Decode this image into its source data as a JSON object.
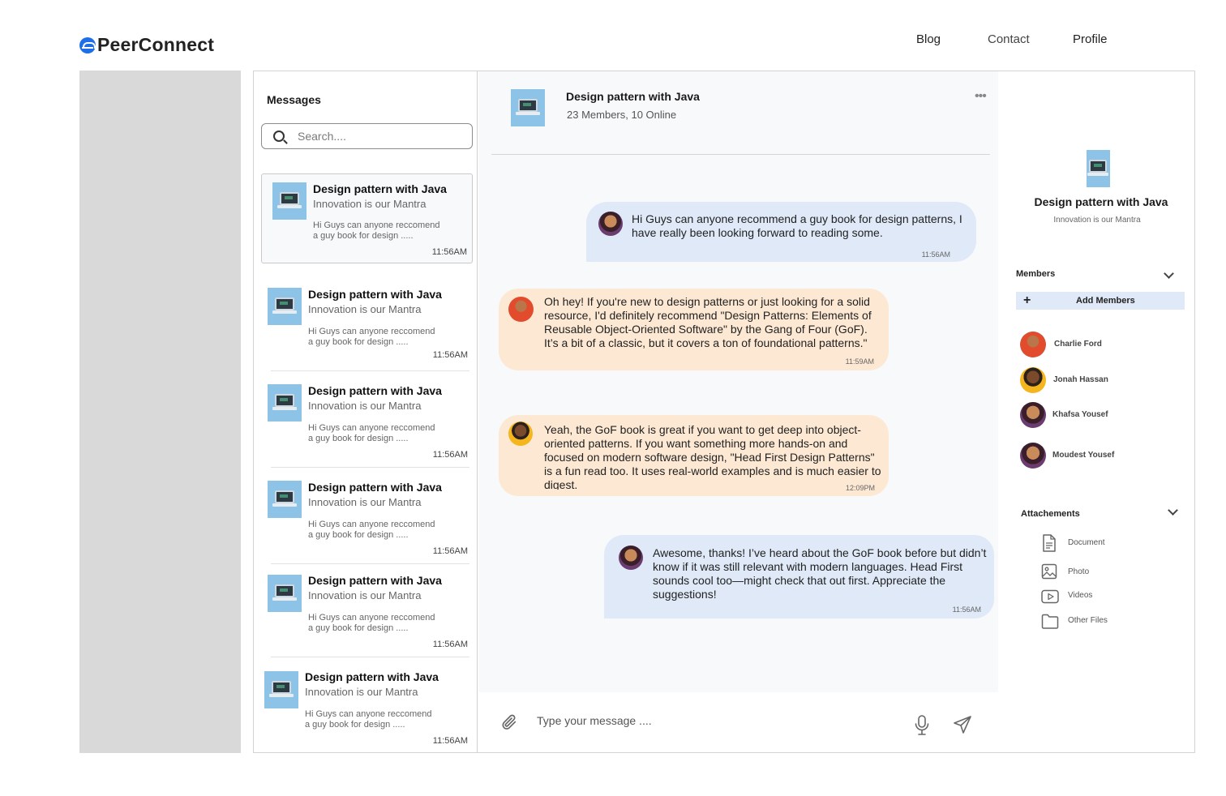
{
  "brand": {
    "name": "PeerConnect",
    "accent": "#1e6ee8"
  },
  "nav": {
    "blog": "Blog",
    "contact": "Contact",
    "profile": "Profile"
  },
  "messages_panel": {
    "title": "Messages",
    "search_placeholder": "Search....",
    "items": [
      {
        "title": "Design pattern with Java",
        "subtitle": "Innovation is our Mantra",
        "preview_line1": "Hi Guys can anyone reccomend",
        "preview_line2": "a guy book for design .....",
        "time": "11:56AM"
      },
      {
        "title": "Design pattern with Java",
        "subtitle": "Innovation is our Mantra",
        "preview_line1": "Hi Guys can anyone reccomend",
        "preview_line2": "a guy book for design .....",
        "time": "11:56AM"
      },
      {
        "title": "Design pattern with Java",
        "subtitle": "Innovation is our Mantra",
        "preview_line1": "Hi Guys can anyone reccomend",
        "preview_line2": "a guy book for design .....",
        "time": "11:56AM"
      },
      {
        "title": "Design pattern with Java",
        "subtitle": "Innovation is our Mantra",
        "preview_line1": "Hi Guys can anyone reccomend",
        "preview_line2": "a guy book for design .....",
        "time": "11:56AM"
      },
      {
        "title": "Design pattern with Java",
        "subtitle": "Innovation is our Mantra",
        "preview_line1": "Hi Guys can anyone reccomend",
        "preview_line2": "a guy book for design .....",
        "time": "11:56AM"
      },
      {
        "title": "Design pattern with Java",
        "subtitle": "Innovation is our Mantra",
        "preview_line1": "Hi Guys can anyone reccomend",
        "preview_line2": "a guy book for design .....",
        "time": "11:56AM"
      }
    ]
  },
  "chat": {
    "title": "Design pattern with Java",
    "subtitle": "23 Members, 10 Online",
    "more_icon": "more-horizontal-icon",
    "messages": [
      {
        "text": "Hi Guys can anyone recommend a guy book for design patterns, I have really been looking forward to reading some.",
        "time": "11:56AM",
        "side": "outgoing"
      },
      {
        "text": "Oh hey! If you're new to design patterns or just looking for a solid resource, I'd definitely recommend \"Design Patterns: Elements of Reusable Object-Oriented Software\" by the Gang of Four (GoF). It’s a bit of a classic, but it covers a ton of foundational patterns.\"",
        "time": "11:59AM",
        "side": "incoming"
      },
      {
        "text": "Yeah, the GoF book is great if you want to get deep into object-oriented patterns. If you want something more hands-on and focused on modern software design, \"Head First Design Patterns\" is a fun read too. It uses real-world examples and is much easier to digest.",
        "time": "12:09PM",
        "side": "incoming"
      },
      {
        "text": "Awesome, thanks! I’ve heard about the GoF book before but didn’t know if it was still relevant with modern languages. Head First sounds cool too—might check that out first. Appreciate the suggestions!",
        "time": "11:56AM",
        "side": "outgoing"
      }
    ],
    "composer_placeholder": "Type your message ....",
    "colors": {
      "outgoing": "#dfe9f8",
      "incoming": "#fde9d3"
    }
  },
  "info": {
    "title": "Design pattern with Java",
    "subtitle": "Innovation is our Mantra",
    "members_label": "Members",
    "add_members_label": "Add Members",
    "members": [
      {
        "name": "Charlie  Ford"
      },
      {
        "name": "Jonah  Hassan"
      },
      {
        "name": "Khafsa Yousef"
      },
      {
        "name": "Moudest Yousef"
      }
    ],
    "attachments_label": "Attachements",
    "attachments": [
      {
        "label": "Document",
        "icon": "document-icon"
      },
      {
        "label": "Photo",
        "icon": "photo-icon"
      },
      {
        "label": "Videos",
        "icon": "video-icon"
      },
      {
        "label": "Other Files",
        "icon": "folder-icon"
      }
    ]
  }
}
